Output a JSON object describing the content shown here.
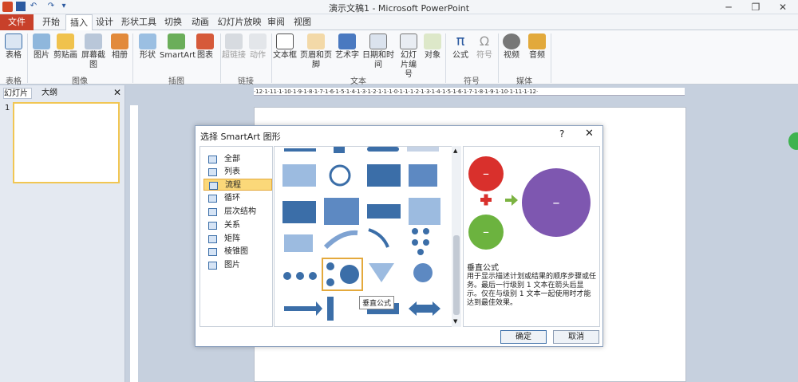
{
  "window": {
    "title": "演示文稿1 - Microsoft PowerPoint"
  },
  "quick_access": [
    "save-icon",
    "undo-icon",
    "redo-icon",
    "customize-icon"
  ],
  "tabs": [
    {
      "label": "文件"
    },
    {
      "label": "开始"
    },
    {
      "label": "插入"
    },
    {
      "label": "设计"
    },
    {
      "label": "形状工具"
    },
    {
      "label": "切换"
    },
    {
      "label": "动画"
    },
    {
      "label": "幻灯片放映"
    },
    {
      "label": "审阅"
    },
    {
      "label": "视图"
    }
  ],
  "ribbon": {
    "buttons": [
      {
        "label": "表格"
      },
      {
        "label": "图片"
      },
      {
        "label": "剪贴画"
      },
      {
        "label": "屏幕截图"
      },
      {
        "label": "相册"
      },
      {
        "label": "形状"
      },
      {
        "label": "SmartArt"
      },
      {
        "label": "图表"
      },
      {
        "label": "超链接"
      },
      {
        "label": "动作"
      },
      {
        "label": "文本框"
      },
      {
        "label": "页眉和页脚"
      },
      {
        "label": "艺术字"
      },
      {
        "label": "日期和时间"
      },
      {
        "label": "幻灯片编号"
      },
      {
        "label": "对象"
      },
      {
        "label": "公式"
      },
      {
        "label": "符号"
      },
      {
        "label": "视频"
      },
      {
        "label": "音频"
      }
    ],
    "groups": [
      {
        "label": "表格"
      },
      {
        "label": "图像"
      },
      {
        "label": "插图"
      },
      {
        "label": "链接"
      },
      {
        "label": "文本"
      },
      {
        "label": "符号"
      },
      {
        "label": "媒体"
      }
    ]
  },
  "left_pane": {
    "tabs": [
      {
        "label": "幻灯片"
      },
      {
        "label": "大纲"
      }
    ],
    "slide_number": "1"
  },
  "ruler": {
    "top": "·12·1·11·1·10·1·9·1·8·1·7·1·6·1·5·1·4·1·3·1·2·1·1·1·0·1·1·1·2·1·3·1·4·1·5·1·6·1·7·1·8·1·9·1·10·1·11·1·12·"
  },
  "dialog": {
    "title": "选择 SmartArt 图形",
    "help": "?",
    "categories": [
      {
        "label": "全部"
      },
      {
        "label": "列表"
      },
      {
        "label": "流程"
      },
      {
        "label": "循环"
      },
      {
        "label": "层次结构"
      },
      {
        "label": "关系"
      },
      {
        "label": "矩阵"
      },
      {
        "label": "棱锥图"
      },
      {
        "label": "图片"
      }
    ],
    "selected_category": "流程",
    "tooltip": "垂直公式",
    "preview_title": "垂直公式",
    "preview_description": "用于显示描述计划或结果的顺序步骤或任务。最后一行级别 1 文本在箭头后显示。仅在与级别 1 文本一起使用时才能达到最佳效果。",
    "ok_label": "确定",
    "cancel_label": "取消"
  },
  "colors": {
    "file_tab": "#c8402a",
    "accent_blue": "#3b6ea8",
    "selected": "#fbd879",
    "red": "#d9302c",
    "green": "#6cb33f",
    "purple": "#7e57b0"
  }
}
